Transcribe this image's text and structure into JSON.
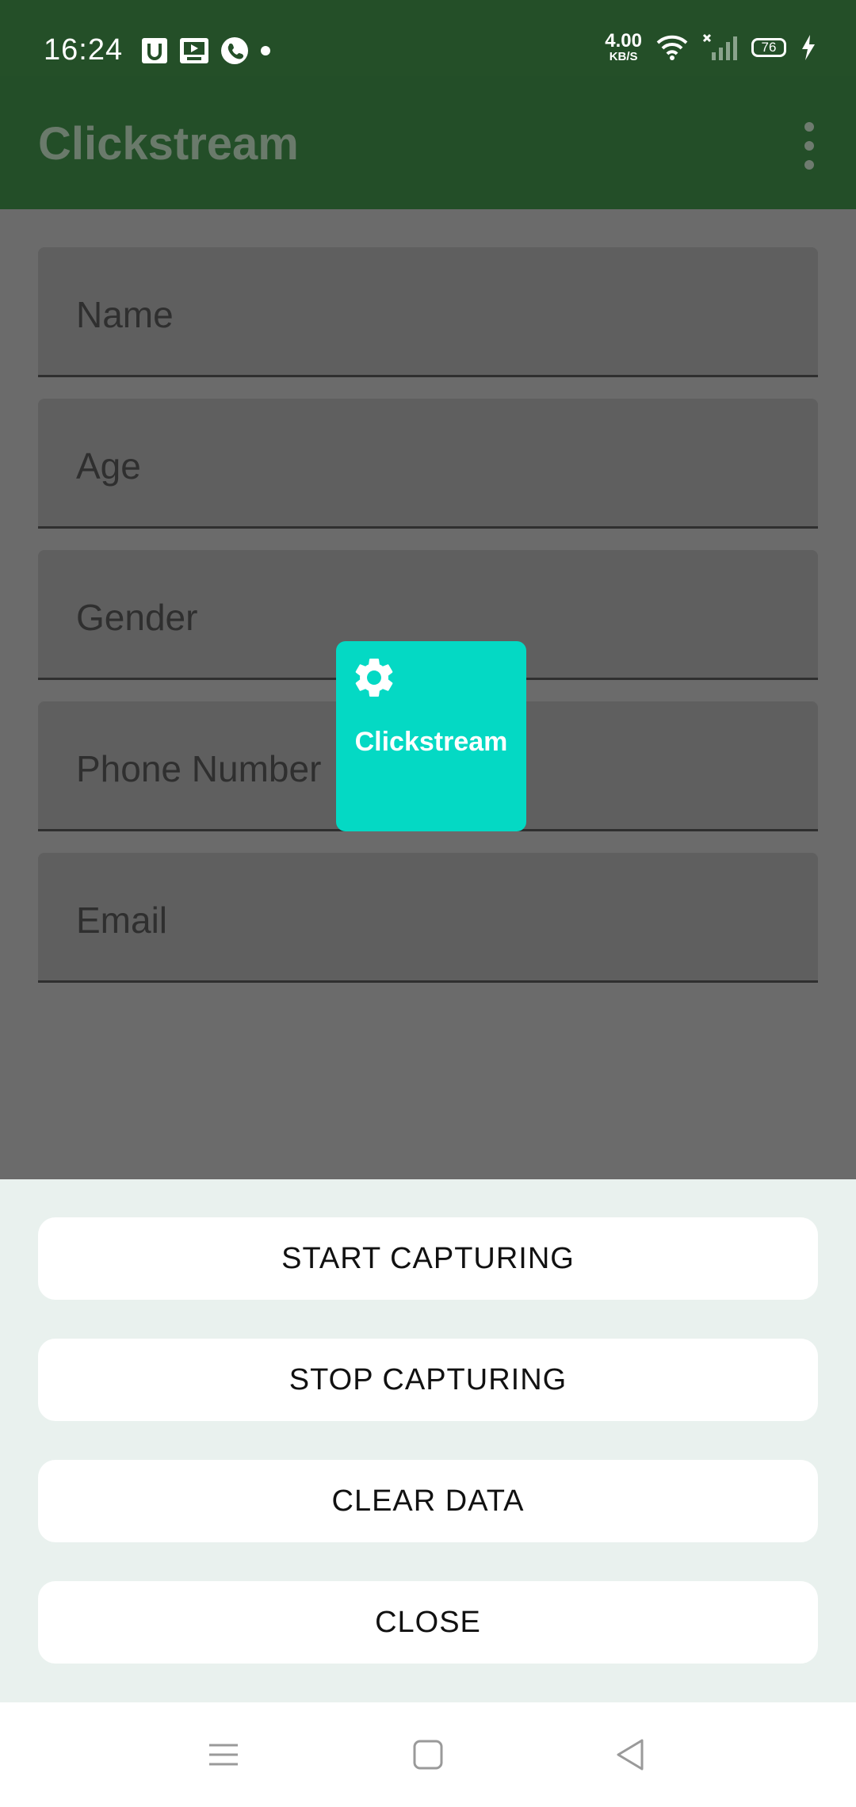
{
  "status_bar": {
    "time": "16:24",
    "net_speed_value": "4.00",
    "net_speed_unit": "KB/S",
    "battery": "76",
    "icons": [
      "u-app-icon",
      "video-icon",
      "phone-icon",
      "dot-icon",
      "wifi-icon",
      "signal-icon",
      "charging-icon"
    ]
  },
  "app_bar": {
    "title": "Clickstream",
    "menu_icon": "overflow-menu-icon"
  },
  "form": {
    "name_placeholder": "Name",
    "age_placeholder": "Age",
    "gender_placeholder": "Gender",
    "phone_placeholder": "Phone Number",
    "email_placeholder": "Email"
  },
  "overlay": {
    "label": "Clickstream",
    "icon": "gear-icon",
    "color": "#04d9c4"
  },
  "sheet": {
    "start_label": "START CAPTURING",
    "stop_label": "STOP CAPTURING",
    "clear_label": "CLEAR DATA",
    "close_label": "CLOSE"
  },
  "nav": {
    "icons": [
      "menu-icon",
      "home-icon",
      "back-icon"
    ]
  },
  "colors": {
    "app_bar": "#234e28",
    "overlay_accent": "#04d9c4",
    "sheet_bg": "#e9f1ee"
  }
}
